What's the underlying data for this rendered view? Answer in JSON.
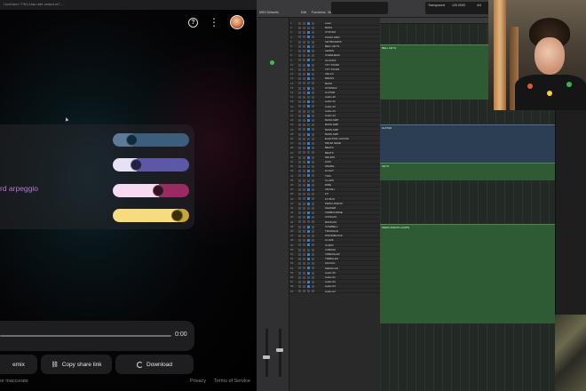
{
  "browser": {
    "address_text": "localhost:7781/show-add-ondevice?..."
  },
  "header": {
    "help_icon": "help-circle-icon",
    "more_icon": "more-vert-icon"
  },
  "controls": {
    "rows": [
      {
        "label": "",
        "value": 0.2,
        "color_fill": "#5e7a9a",
        "color_rest": "#3c5e7c",
        "knob": "#0d2a3a"
      },
      {
        "label": "",
        "value": 0.28,
        "color_fill": "#e6e2f3",
        "color_rest": "#5c58a6",
        "knob": "#221f4a"
      },
      {
        "label": "rd arpeggio",
        "value": 0.62,
        "color_fill": "#f7d9f2",
        "color_rest": "#9c2a62",
        "knob": "#3a0f24"
      },
      {
        "label": "",
        "value": 0.9,
        "color_fill": "#f6dc7c",
        "color_rest": "#c9a63a",
        "knob": "#3c3000"
      }
    ]
  },
  "player": {
    "time": "0:00",
    "progress": 0
  },
  "actions": {
    "remix_label": "emix",
    "share_label": "Copy share link",
    "download_label": "Download"
  },
  "footer": {
    "disclaimer": "or inaccurate",
    "privacy": "Privacy",
    "terms": "Terms of Service"
  },
  "daw": {
    "view_label": "MIDI Defaults",
    "menu": [
      "Edit",
      "Functions",
      "View"
    ],
    "tempo_label": "Transposed",
    "tempo_value": "120.0000",
    "sig_value": "4/4",
    "regions": [
      {
        "label": "BELL KEYS",
        "type": "green"
      },
      {
        "label": "GUITAR",
        "type": "blue"
      },
      {
        "label": "KEYS",
        "type": "green"
      },
      {
        "label": "PERCUSSION LOOPS",
        "type": "green"
      }
    ],
    "tracks": [
      "Lead",
      "BASS",
      "SYNTHS",
      "PIANO MIDI",
      "KEYBOARDS",
      "BELL KEYS",
      "LEADS",
      "OVERHEAD",
      "GLOCKS",
      "TOY PIANO",
      "TOY PIANO",
      "CELLO",
      "BRASS",
      "BASS",
      "STRINGS",
      "GUITAR",
      "Audio 20",
      "Audio 21",
      "Audio 22",
      "Audio 23",
      "Audio 24",
      "BASS AMP",
      "BASS AMP",
      "BASS AMP",
      "BASS AMP",
      "ELECTRIC GUITAR",
      "DRUM SEND",
      "BEATS",
      "BEATS",
      "DRUMS",
      "KICK",
      "SNARE",
      "HI-HAT",
      "TOM",
      "CLAPS",
      "RIDE",
      "CRASH",
      "FX",
      "FX BUS",
      "PERCUSSION",
      "SHAKER",
      "TAMBOURINE",
      "CONGAS",
      "BONGOS",
      "COWBELL",
      "TRIANGLE",
      "WOODBLOCK",
      "CLAVE",
      "GUIRO",
      "CABASA",
      "VIBRASLAP",
      "TIMBALES",
      "AGOGO",
      "MARACAS",
      "Audio 60",
      "Audio 61",
      "Audio 62",
      "Audio 63",
      "Audio 64"
    ]
  },
  "colors": {
    "accent_label": "#b57ad0",
    "region_green": "#2e5a34",
    "region_blue": "#2c3f52"
  }
}
